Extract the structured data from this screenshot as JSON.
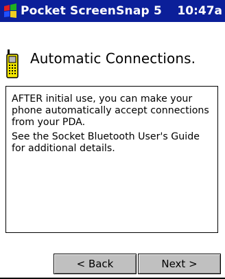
{
  "titlebar": {
    "app_title": "Pocket ScreenSnap 5",
    "time": "10:47a",
    "bg_color": "#0b1f99"
  },
  "page": {
    "heading": "Automatic Connections.",
    "icon": "phone-icon"
  },
  "info": {
    "paragraph1": "AFTER initial use, you can make your phone automatically accept connections from your PDA.",
    "paragraph2": "See the Socket Bluetooth User's Guide for additional details."
  },
  "buttons": {
    "back_label": "< Back",
    "next_label": "Next >"
  }
}
